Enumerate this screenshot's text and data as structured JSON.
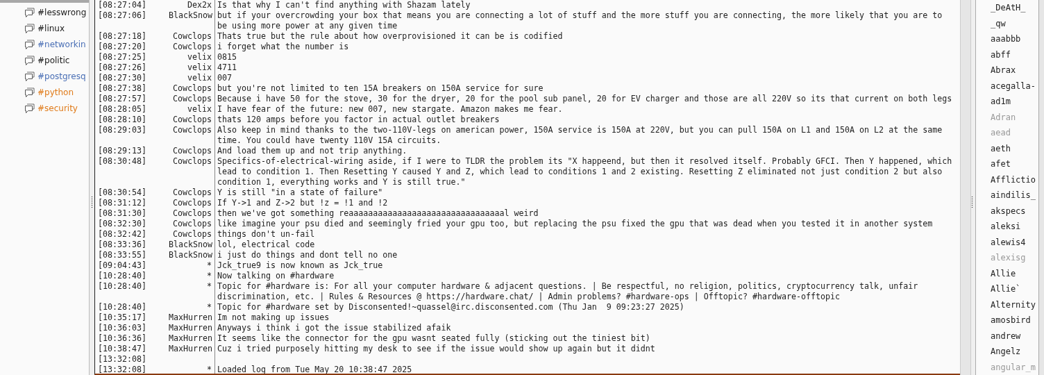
{
  "channels": [
    {
      "name": "#lesswrong",
      "color": "#1a1a1a"
    },
    {
      "name": "#linux",
      "color": "#1a1a1a"
    },
    {
      "name": "#networkin",
      "color": "#4a6fb5"
    },
    {
      "name": "#politic",
      "color": "#1a1a1a"
    },
    {
      "name": "#postgresq",
      "color": "#4a6fb5"
    },
    {
      "name": "#python",
      "color": "#e07b1a"
    },
    {
      "name": "#security",
      "color": "#e07b1a"
    }
  ],
  "messages": [
    {
      "time": "[08:27:04]",
      "nick": "Dex2x",
      "text": "Is that why I can't find anything with Shazam lately"
    },
    {
      "time": "[08:27:06]",
      "nick": "BlackSnow",
      "text": "but if your overcrowding your box that means you are connecting a lot of stuff and the more stuff you are connecting, the more likely that you are to be using more power at any given time"
    },
    {
      "time": "[08:27:18]",
      "nick": "Cowclops",
      "text": "Thats true but the rule about how overprovisioned it can be is codified"
    },
    {
      "time": "[08:27:20]",
      "nick": "Cowclops",
      "text": "i forget what the number is"
    },
    {
      "time": "[08:27:25]",
      "nick": "velix",
      "text": "0815"
    },
    {
      "time": "[08:27:26]",
      "nick": "velix",
      "text": "4711"
    },
    {
      "time": "[08:27:30]",
      "nick": "velix",
      "text": "007"
    },
    {
      "time": "[08:27:38]",
      "nick": "Cowclops",
      "text": "but you're not limited to ten 15A breakers on 150A service for sure"
    },
    {
      "time": "[08:27:57]",
      "nick": "Cowclops",
      "text": "Because i have 50 for the stove, 30 for the dryer, 20 for the pool sub panel, 20 for EV charger and those are all 220V so its that current on both legs"
    },
    {
      "time": "[08:28:05]",
      "nick": "velix",
      "text": "I have fear of the future: new 007, new stargate. Amazon makes me fear."
    },
    {
      "time": "[08:28:10]",
      "nick": "Cowclops",
      "text": "thats 120 amps before you factor in actual outlet breakers"
    },
    {
      "time": "[08:29:03]",
      "nick": "Cowclops",
      "text": "Also keep in mind thanks to the two-110V-legs on american power, 150A service is 150A at 220V, but you can pull 150A on L1 and 150A on L2 at the same time. You could have twenty 110V 15A circuits."
    },
    {
      "time": "[08:29:13]",
      "nick": "Cowclops",
      "text": "And load them up and not trip anything."
    },
    {
      "time": "[08:30:48]",
      "nick": "Cowclops",
      "text": "Specifics-of-electrical-wiring aside, if I were to TLDR the problem its \"X happeend, but then it resolved itself. Probably GFCI. Then Y happened, which lead to condition 1. Then Resetting Y caused Y and Z, which lead to conditions 1 and 2 existing. Resetting Z eliminated not just condition 2 but also condition 1, everything works and Y is still true.\""
    },
    {
      "time": "[08:30:54]",
      "nick": "Cowclops",
      "text": "Y is still \"in a state of failure\""
    },
    {
      "time": "[08:31:12]",
      "nick": "Cowclops",
      "text": "If Y->1 and Z->2 but !z = !1 and !2"
    },
    {
      "time": "[08:31:30]",
      "nick": "Cowclops",
      "text": "then we've got something reaaaaaaaaaaaaaaaaaaaaaaaaaaaaaaaal weird"
    },
    {
      "time": "[08:32:30]",
      "nick": "Cowclops",
      "text": "like imagine your psu died and seemingly fried your gpu too, but replacing the psu fixed the gpu that was dead when you tested it in another system"
    },
    {
      "time": "[08:32:42]",
      "nick": "Cowclops",
      "text": "things don't un-fail"
    },
    {
      "time": "[08:33:36]",
      "nick": "BlackSnow",
      "text": "lol, electrical code"
    },
    {
      "time": "[08:33:55]",
      "nick": "BlackSnow",
      "text": "i just do things and dont tell no one"
    },
    {
      "time": "[09:04:43]",
      "nick": "*",
      "text": "Jck_true9 is now known as Jck_true"
    },
    {
      "time": "[10:28:40]",
      "nick": "*",
      "text": "Now talking on #hardware"
    },
    {
      "time": "[10:28:40]",
      "nick": "*",
      "text": "Topic for #hardware is: For all your computer hardware & adjacent questions. | Be respectful, no religion, politics, cryptocurrency talk, unfair discrimination, etc. | Rules & Resources @ https://hardware.chat/ | Admin problems? #hardware-ops | Offtopic? #hardware-offtopic"
    },
    {
      "time": "[10:28:40]",
      "nick": "*",
      "text": "Topic for #hardware set by Disconsented!~quassel@irc.disconsented.com (Thu Jan  9 09:23:27 2025)"
    },
    {
      "time": "[10:35:17]",
      "nick": "MaxHurren",
      "text": "Im not making up issues"
    },
    {
      "time": "[10:36:03]",
      "nick": "MaxHurren",
      "text": "Anyways i think i got the issue stabilized afaik"
    },
    {
      "time": "[10:36:36]",
      "nick": "MaxHurren",
      "text": "It seems like the connector for the gpu wasnt seated fully (sticking out the tiniest bit)"
    },
    {
      "time": "[10:38:47]",
      "nick": "MaxHurren",
      "text": "Cuz i tried purposely hitting my desk to see if the issue would show up again but it didnt"
    },
    {
      "time": "[13:32:08]"
    },
    {
      "time": "[13:32:08]",
      "nick": "*",
      "text": "Loaded log from Tue May 20 10:38:47 2025"
    }
  ],
  "users": [
    {
      "nick": "_DeAtH_",
      "away": false
    },
    {
      "nick": "_qw",
      "away": false
    },
    {
      "nick": "aaabbb",
      "away": false
    },
    {
      "nick": "abff",
      "away": false
    },
    {
      "nick": "Abrax",
      "away": false
    },
    {
      "nick": "acegalla-",
      "away": false
    },
    {
      "nick": "ad1m",
      "away": false
    },
    {
      "nick": "Adran",
      "away": true
    },
    {
      "nick": "aead",
      "away": true
    },
    {
      "nick": "aeth",
      "away": false
    },
    {
      "nick": "afet",
      "away": false
    },
    {
      "nick": "Afflictio",
      "away": false
    },
    {
      "nick": "aindilis_",
      "away": false
    },
    {
      "nick": "akspecs",
      "away": false
    },
    {
      "nick": "aleksi",
      "away": false
    },
    {
      "nick": "alewis4",
      "away": false
    },
    {
      "nick": "alexisg",
      "away": true
    },
    {
      "nick": "Allie",
      "away": false
    },
    {
      "nick": "Allie`",
      "away": false
    },
    {
      "nick": "Alternity",
      "away": false
    },
    {
      "nick": "amosbird",
      "away": false
    },
    {
      "nick": "andrew",
      "away": false
    },
    {
      "nick": "Angelz",
      "away": false
    },
    {
      "nick": "angular_m",
      "away": true
    }
  ]
}
